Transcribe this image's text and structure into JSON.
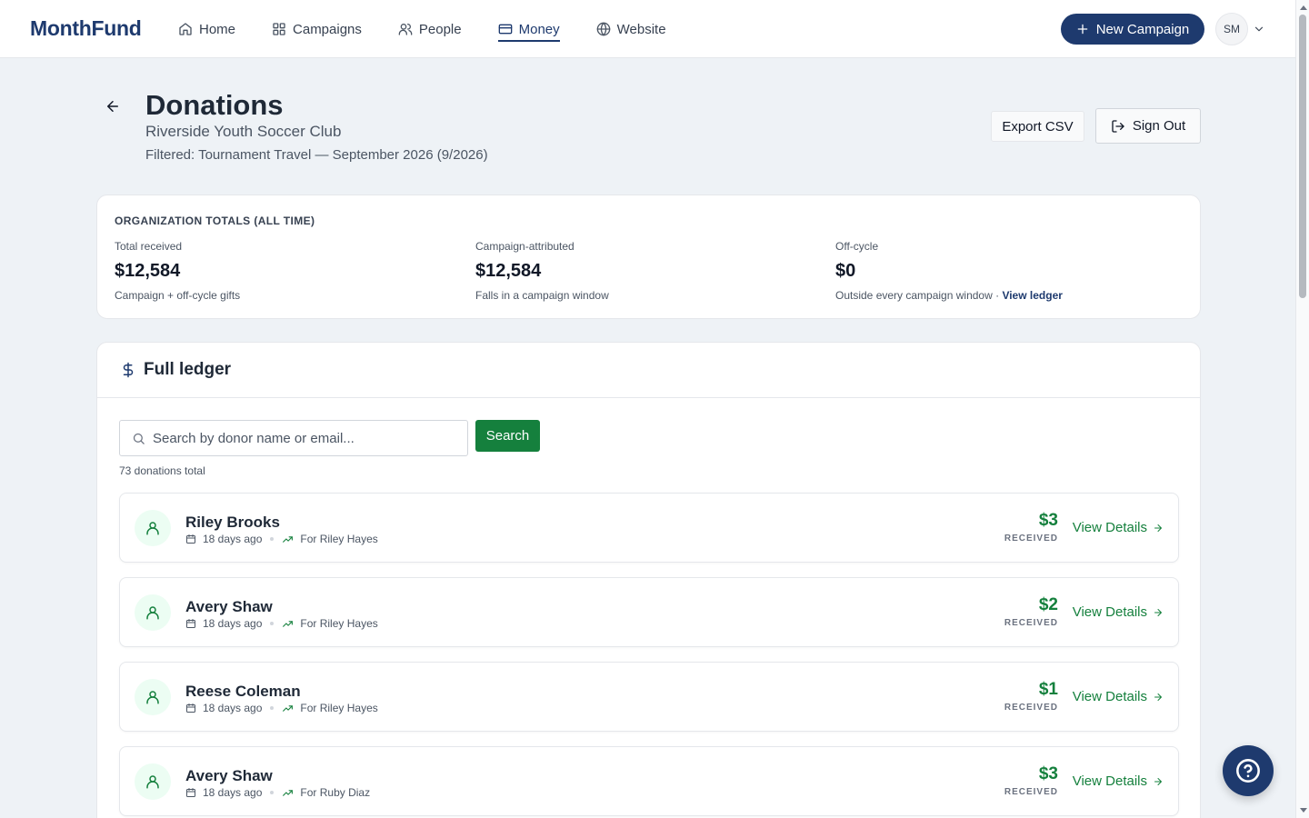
{
  "app": {
    "logo": "MonthFund"
  },
  "nav": {
    "items": [
      {
        "label": "Home",
        "icon": "home-icon"
      },
      {
        "label": "Campaigns",
        "icon": "grid-icon"
      },
      {
        "label": "People",
        "icon": "users-icon"
      },
      {
        "label": "Money",
        "icon": "wallet-icon",
        "active": true
      },
      {
        "label": "Website",
        "icon": "globe-icon"
      }
    ],
    "new_campaign": "New Campaign",
    "avatar_initials": "SM"
  },
  "header": {
    "title": "Donations",
    "organization": "Riverside Youth Soccer Club",
    "filter": "Filtered: Tournament Travel — September 2026 (9/2026)",
    "export_label": "Export CSV",
    "signout_label": "Sign Out"
  },
  "totals": {
    "heading": "ORGANIZATION TOTALS (ALL TIME)",
    "stats": [
      {
        "label": "Total received",
        "value": "$12,584",
        "sub": "Campaign + off-cycle gifts"
      },
      {
        "label": "Campaign-attributed",
        "value": "$12,584",
        "sub": "Falls in a campaign window"
      },
      {
        "label": "Off-cycle",
        "value": "$0",
        "sub": "Outside every campaign window ·",
        "link": "View ledger"
      }
    ]
  },
  "ledger": {
    "title": "Full ledger",
    "search_placeholder": "Search by donor name or email...",
    "search_button": "Search",
    "count": "73 donations total",
    "status_label": "RECEIVED",
    "details_label": "View Details",
    "rows": [
      {
        "name": "Riley Brooks",
        "date": "18 days ago",
        "for": "For Riley Hayes",
        "amount": "$3"
      },
      {
        "name": "Avery Shaw",
        "date": "18 days ago",
        "for": "For Riley Hayes",
        "amount": "$2"
      },
      {
        "name": "Reese Coleman",
        "date": "18 days ago",
        "for": "For Riley Hayes",
        "amount": "$1"
      },
      {
        "name": "Avery Shaw",
        "date": "18 days ago",
        "for": "For Ruby Diaz",
        "amount": "$3"
      }
    ]
  },
  "colors": {
    "brand": "#1e3a6e",
    "accent_green": "#15803d",
    "background": "#eef2f6"
  }
}
